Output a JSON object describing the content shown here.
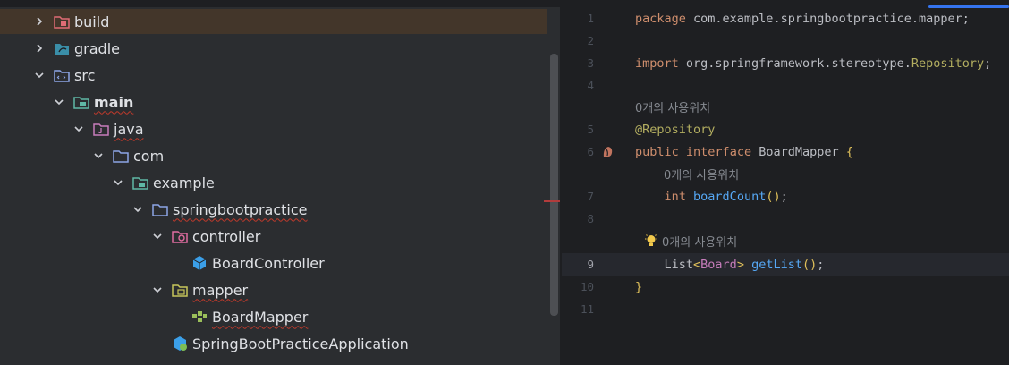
{
  "tree": {
    "items": [
      {
        "label": "build",
        "icon": "build-folder-icon"
      },
      {
        "label": "gradle",
        "icon": "gradle-folder-icon"
      },
      {
        "label": "src",
        "icon": "source-folder-icon"
      },
      {
        "label": "main",
        "icon": "module-folder-icon"
      },
      {
        "label": "java",
        "icon": "java-source-root-icon"
      },
      {
        "label": "com",
        "icon": "package-folder-icon"
      },
      {
        "label": "example",
        "icon": "package-folder-icon"
      },
      {
        "label": "springbootpractice",
        "icon": "package-folder-icon"
      },
      {
        "label": "controller",
        "icon": "controller-package-icon"
      },
      {
        "label": "BoardController",
        "icon": "spring-bean-class-icon"
      },
      {
        "label": "mapper",
        "icon": "mapper-package-icon"
      },
      {
        "label": "BoardMapper",
        "icon": "mybatis-mapper-icon"
      },
      {
        "label": "SpringBootPracticeApplication",
        "icon": "spring-boot-application-icon"
      }
    ]
  },
  "editor": {
    "line_numbers": [
      "1",
      "2",
      "3",
      "4",
      "5",
      "6",
      "7",
      "8",
      "9",
      "10",
      "11"
    ],
    "usage_hint": "0개의 사용위치",
    "lines": {
      "l1": {
        "kw": "package",
        "rest": " com.example.springbootpractice.mapper;"
      },
      "l3": {
        "kw": "import",
        "rest": " org.springframework.stereotype.",
        "cls": "Repository",
        "end": ";"
      },
      "l5": {
        "ann": "@Repository"
      },
      "l6": {
        "kw1": "public",
        "kw2": "interface",
        "name": "BoardMapper",
        "brace": "{"
      },
      "l7": {
        "indent": "    ",
        "kw": "int",
        "fn": "boardCount",
        "paren": "()",
        "end": ";"
      },
      "l9": {
        "indent": "    ",
        "type": "List",
        "lt": "<",
        "gen": "Board",
        "gt": ">",
        "fn": "getList",
        "paren": "()",
        "end": ";"
      },
      "l10": {
        "brace": "}"
      }
    }
  },
  "colors": {
    "keyword": "#cf8e6d",
    "annotation": "#b3ae60",
    "type": "#c77dbb",
    "function": "#56a8f5",
    "paren": "#e0c05a",
    "selection": "#43362a"
  }
}
